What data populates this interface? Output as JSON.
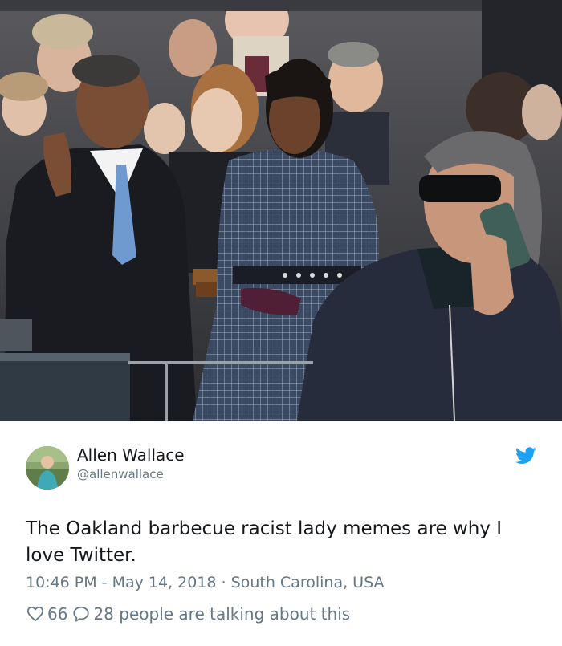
{
  "tweet": {
    "author_name": "Allen Wallace",
    "author_handle": "@allenwallace",
    "text": "The Oakland barbecue racist lady memes are why I love Twitter.",
    "timestamp": "10:46 PM - May 14, 2018",
    "separator": "·",
    "location": "South Carolina, USA",
    "likes": "66",
    "talking": "28 people are talking about this"
  },
  "icons": {
    "brand": "twitter-bird-icon",
    "like": "heart-icon",
    "reply": "speech-bubble-icon"
  },
  "colors": {
    "brand_blue": "#1da1f2",
    "muted_text": "#657786",
    "primary_text": "#14171a",
    "border": "#e1e8ed"
  }
}
